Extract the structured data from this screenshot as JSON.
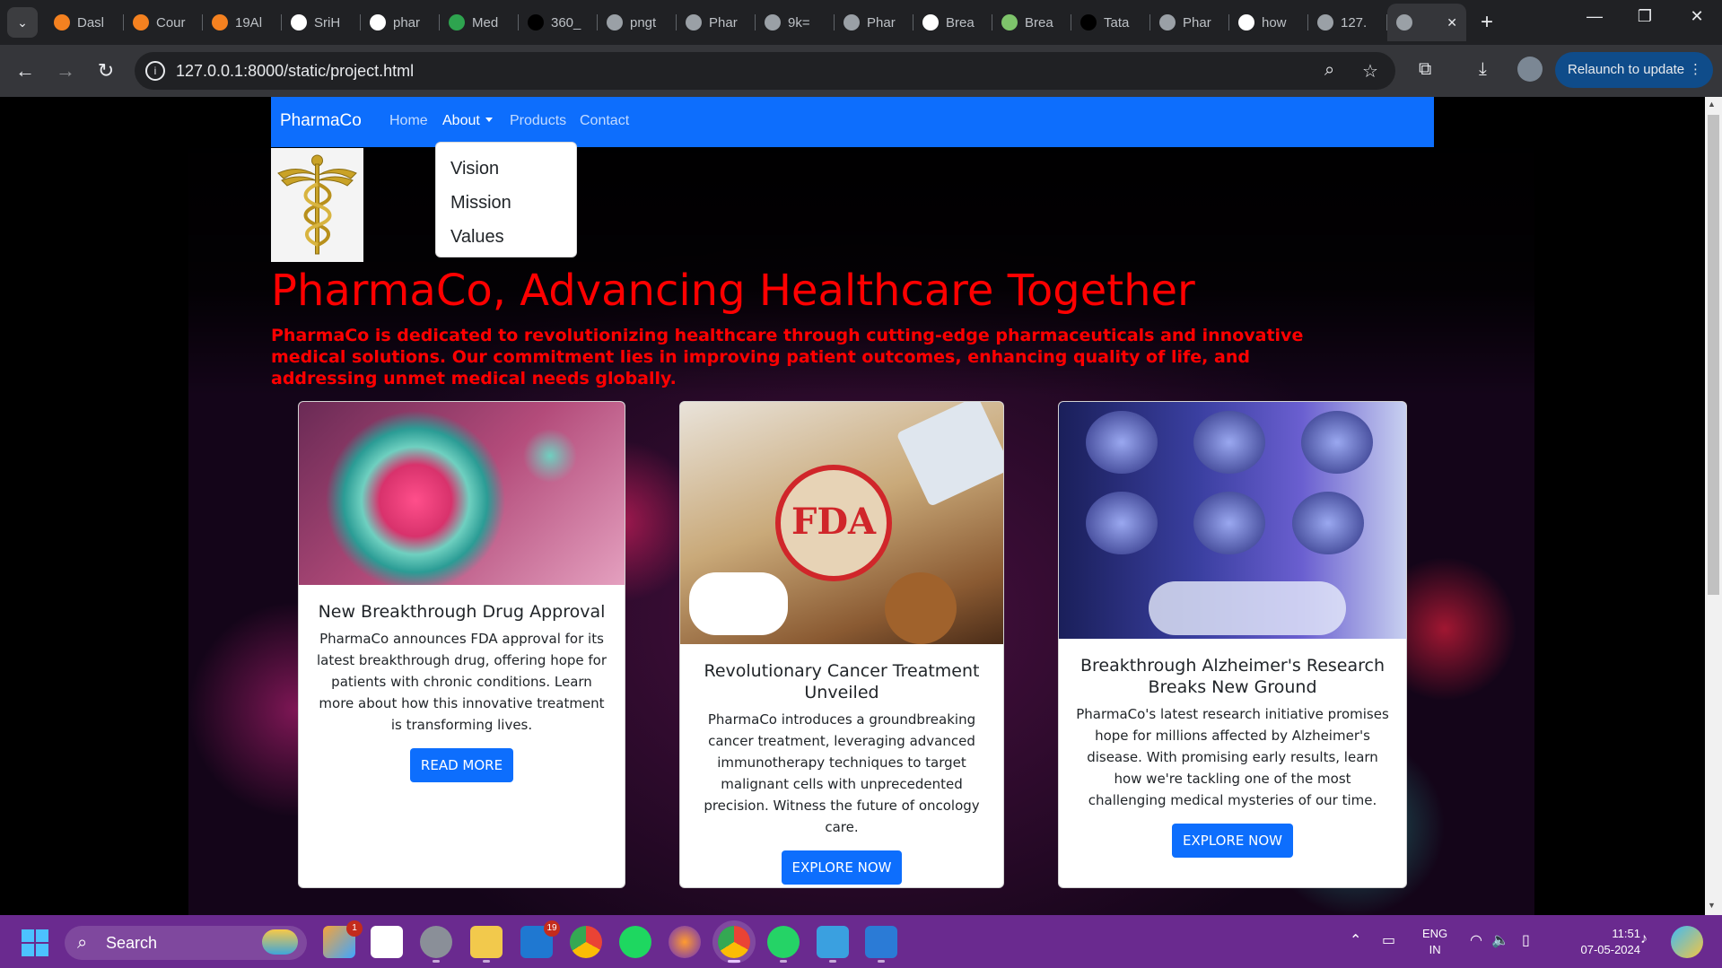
{
  "browser": {
    "tabs": [
      {
        "label": "Dasl",
        "icon": "m-icon",
        "color": "#f48120"
      },
      {
        "label": "Cour",
        "icon": "m-icon",
        "color": "#f48120"
      },
      {
        "label": "19Al",
        "icon": "m-icon",
        "color": "#f48120"
      },
      {
        "label": "SriH",
        "icon": "github-icon",
        "color": "#ffffff"
      },
      {
        "label": "phar",
        "icon": "google-icon",
        "color": "#ffffff"
      },
      {
        "label": "Med",
        "icon": "p-icon",
        "color": "#2ea44f"
      },
      {
        "label": "360_",
        "icon": "st-icon",
        "color": "#000000"
      },
      {
        "label": "pngt",
        "icon": "globe-icon",
        "color": "#9aa0a6"
      },
      {
        "label": "Phar",
        "icon": "globe-icon",
        "color": "#9aa0a6"
      },
      {
        "label": "9k=",
        "icon": "globe-icon",
        "color": "#9aa0a6"
      },
      {
        "label": "Phar",
        "icon": "globe-icon",
        "color": "#9aa0a6"
      },
      {
        "label": "Brea",
        "icon": "google-icon",
        "color": "#ffffff"
      },
      {
        "label": "Brea",
        "icon": "lock-icon",
        "color": "#7ec46b"
      },
      {
        "label": "Tata",
        "icon": "medium-icon",
        "color": "#000000"
      },
      {
        "label": "Phar",
        "icon": "globe-icon",
        "color": "#9aa0a6"
      },
      {
        "label": "how",
        "icon": "google-icon",
        "color": "#ffffff"
      },
      {
        "label": "127.",
        "icon": "globe-icon",
        "color": "#9aa0a6"
      },
      {
        "label": "",
        "icon": "globe-icon",
        "color": "#9aa0a6",
        "active": true
      }
    ],
    "url": "127.0.0.1:8000/static/project.html",
    "relaunch_label": "Relaunch to update"
  },
  "navbar": {
    "brand": "PharmaCo",
    "links": [
      "Home",
      "About",
      "Products",
      "Contact"
    ],
    "dropdown": [
      "Vision",
      "Mission",
      "Values"
    ],
    "bg_color": "#0d6efd"
  },
  "hero": {
    "title": "PharmaCo, Advancing Healthcare Together",
    "text": "PharmaCo is dedicated to revolutionizing healthcare through cutting-edge pharmaceuticals and innovative medical solutions. Our commitment lies in improving patient outcomes, enhancing quality of life, and addressing unmet medical needs globally.",
    "title_color": "#ff0000"
  },
  "cards": [
    {
      "title": "New Breakthrough Drug Approval",
      "text": "PharmaCo announces FDA approval for its latest breakthrough drug, offering hope for patients with chronic conditions. Learn more about how this innovative treatment is transforming lives.",
      "button": "READ MORE",
      "image": "virus-cell-image"
    },
    {
      "title": "Revolutionary Cancer Treatment Unveiled",
      "text": "PharmaCo introduces a groundbreaking cancer treatment, leveraging advanced immunotherapy techniques to target malignant cells with unprecedented precision. Witness the future of oncology care.",
      "button": "EXPLORE NOW",
      "image": "fda-approved-image",
      "stamp_text": "FDA"
    },
    {
      "title": "Breakthrough Alzheimer's Research Breaks New Ground",
      "text": "PharmaCo's latest research initiative promises hope for millions affected by Alzheimer's disease. With promising early results, learn how we're tackling one of the most challenging medical mysteries of our time.",
      "button": "EXPLORE NOW",
      "image": "brain-scan-image"
    }
  ],
  "taskbar": {
    "search_label": "Search",
    "badges": {
      "copilot": "1",
      "store": "19"
    },
    "lang_line1": "ENG",
    "lang_line2": "IN",
    "time": "11:51",
    "date": "07-05-2024"
  }
}
